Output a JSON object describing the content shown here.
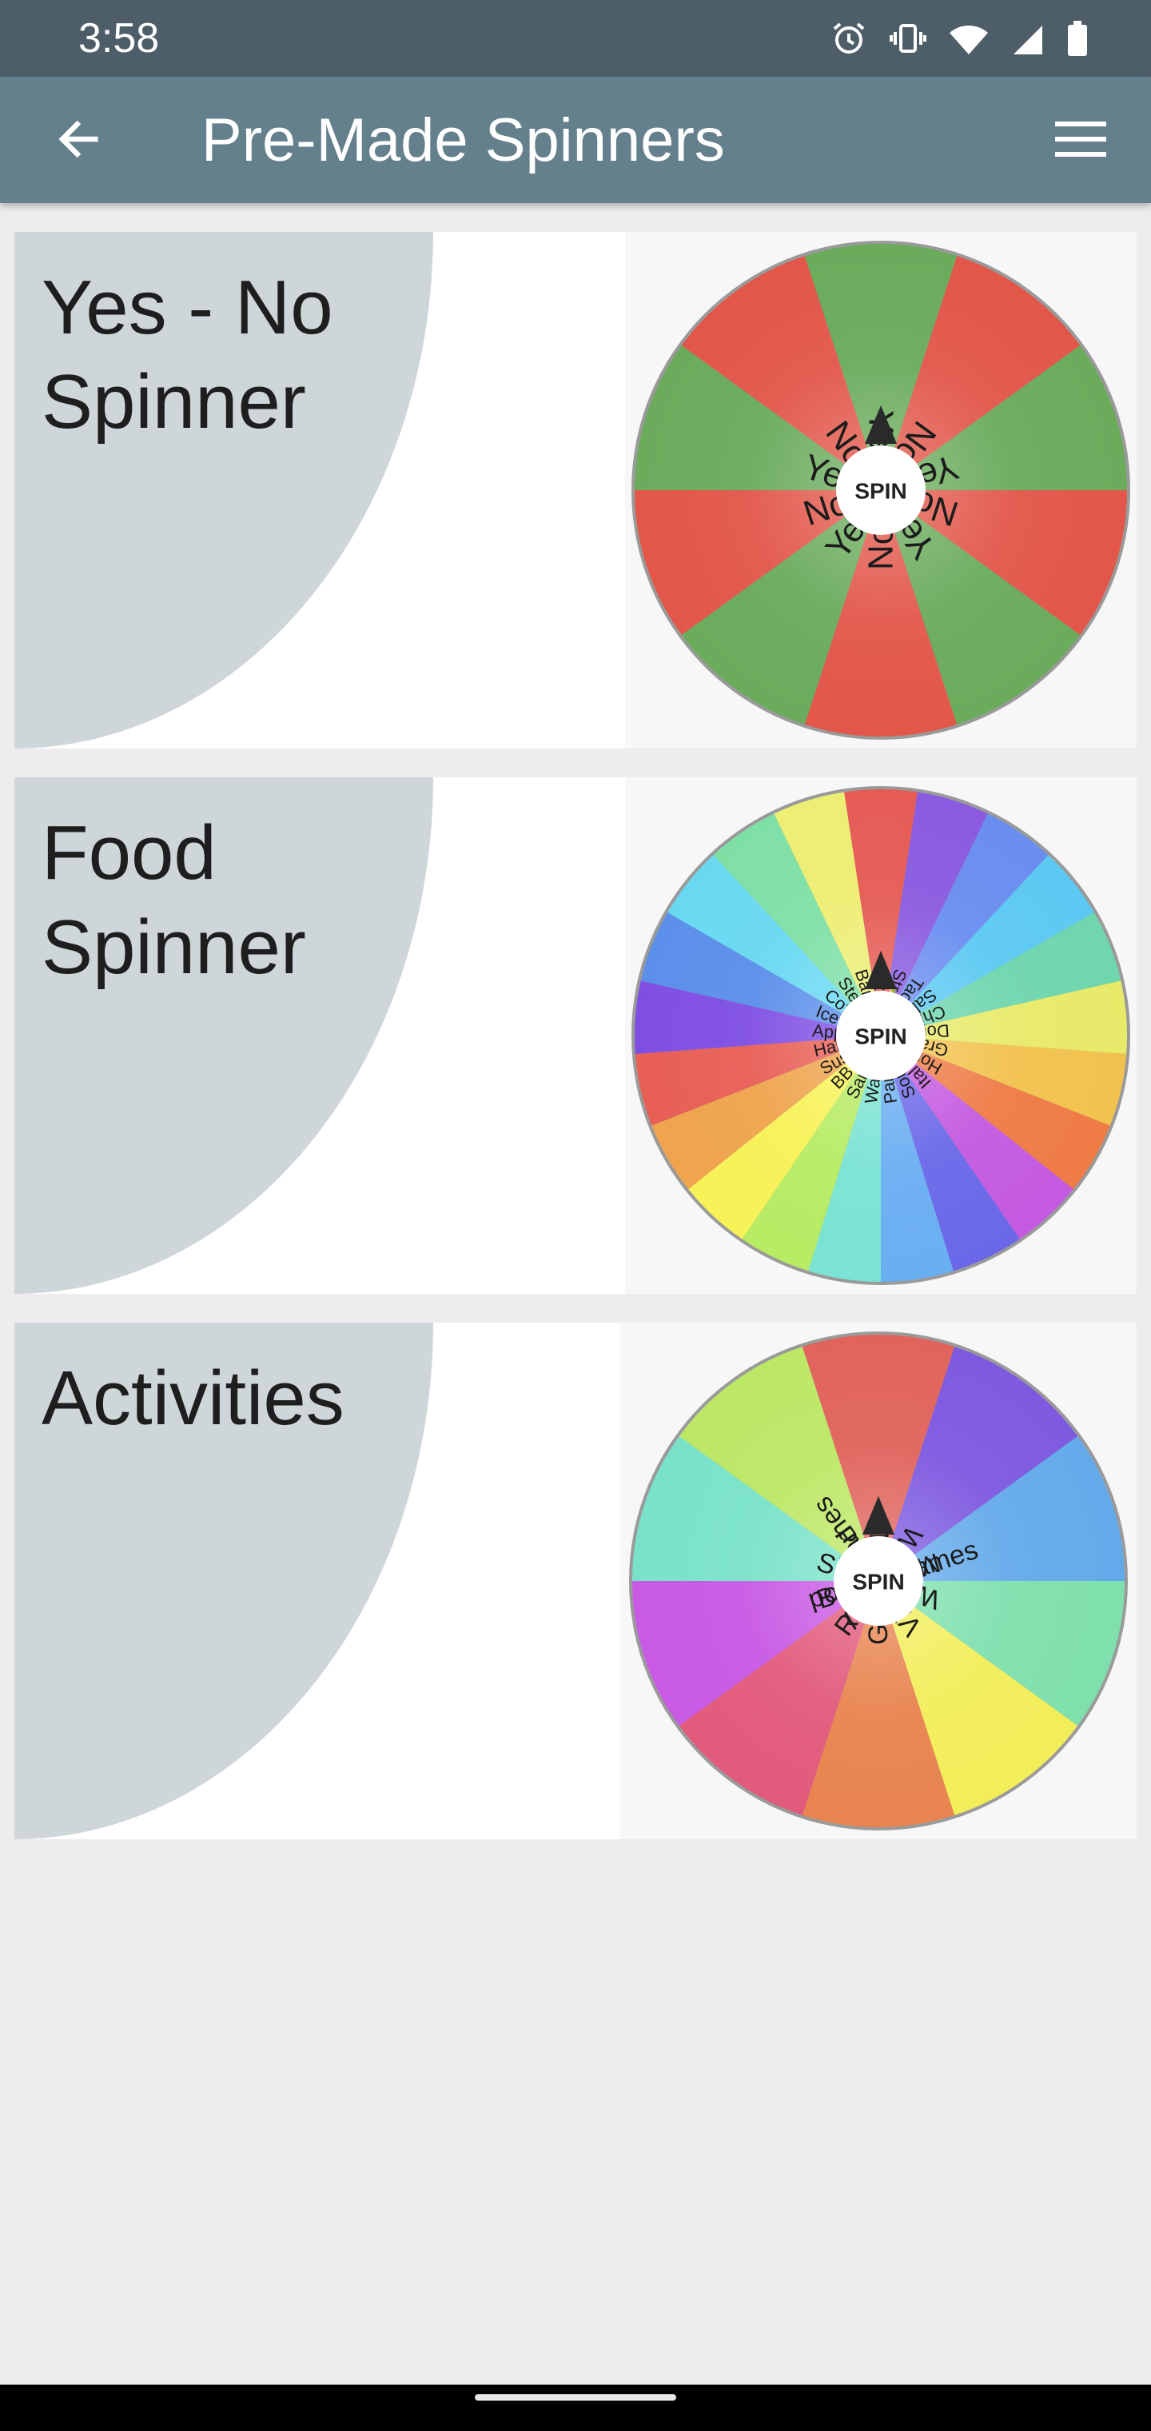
{
  "status_bar": {
    "time": "3:58",
    "icons": [
      "alarm-icon",
      "vibrate-icon",
      "wifi-icon",
      "signal-icon",
      "battery-icon"
    ]
  },
  "app_bar": {
    "title": "Pre-Made Spinners",
    "back_icon": "arrow-left-icon",
    "menu_icon": "hamburger-menu-icon",
    "color": "#65808d"
  },
  "spinners": [
    {
      "title": "Yes - No Spinner",
      "spin_label": "SPIN",
      "segments": [
        {
          "label": "Yes",
          "color": "#6aab5c"
        },
        {
          "label": "No",
          "color": "#e2574a"
        },
        {
          "label": "Yes",
          "color": "#6aab5c"
        },
        {
          "label": "No",
          "color": "#e2574a"
        },
        {
          "label": "Yes",
          "color": "#6aab5c"
        },
        {
          "label": "No",
          "color": "#e2574a"
        },
        {
          "label": "Yes",
          "color": "#6aab5c"
        },
        {
          "label": "No",
          "color": "#e2574a"
        },
        {
          "label": "Yes",
          "color": "#6aab5c"
        },
        {
          "label": "No",
          "color": "#e2574a"
        }
      ]
    },
    {
      "title": "Food Spinner",
      "spin_label": "SPIN",
      "segments": [
        {
          "label": "Pizza",
          "emoji": "🍕",
          "color": "#e55c55"
        },
        {
          "label": "Straberries",
          "emoji": "🍓",
          "color": "#8a5be0"
        },
        {
          "label": "Tacos",
          "emoji": "🌮",
          "color": "#6a8ef0"
        },
        {
          "label": "Salad",
          "emoji": "🥗",
          "color": "#5cc9f2"
        },
        {
          "label": "Chinese",
          "emoji": "🥡",
          "color": "#6fd6ae"
        },
        {
          "label": "Doughnuts",
          "emoji": "🍩",
          "color": "#e8ea6a"
        },
        {
          "label": "Grapes",
          "emoji": "🍇",
          "color": "#f2c24e"
        },
        {
          "label": "Hot Dog",
          "emoji": "🌭",
          "color": "#ef7b45"
        },
        {
          "label": "Italian",
          "emoji": "🍝",
          "color": "#c45ae0"
        },
        {
          "label": "Soup",
          "emoji": "🍜",
          "color": "#6a68e8"
        },
        {
          "label": "Pancakes",
          "emoji": "🥞",
          "color": "#6aaef2"
        },
        {
          "label": "Watermelon",
          "emoji": "🍉",
          "color": "#7ae3d3"
        },
        {
          "label": "Sandwich",
          "emoji": "🥪",
          "color": "#b7ec64"
        },
        {
          "label": "BBQ",
          "emoji": "🍖",
          "color": "#f7f257"
        },
        {
          "label": "Sushi",
          "emoji": "🍣",
          "color": "#efa44d"
        },
        {
          "label": "Hamburger",
          "emoji": "🍔",
          "color": "#e85f56"
        },
        {
          "label": "Apples",
          "emoji": "🍎",
          "color": "#7f4fe3"
        },
        {
          "label": "Ice Cream",
          "emoji": "🍦",
          "color": "#5b8fea"
        },
        {
          "label": "Coffee",
          "emoji": "☕",
          "color": "#69d9f2"
        },
        {
          "label": "Steak",
          "emoji": "🥩",
          "color": "#7fe0a6"
        },
        {
          "label": "Bananas",
          "emoji": "🍌",
          "color": "#edee74"
        }
      ]
    },
    {
      "title": "Activities",
      "spin_label": "SPIN",
      "segments": [
        {
          "label": "Movie",
          "color": "#e0645c"
        },
        {
          "label": "Watch TV",
          "color": "#7e5ae0"
        },
        {
          "label": "Make Food",
          "color": "#64aaea"
        },
        {
          "label": "Workout",
          "color": "#7fe0ad"
        },
        {
          "label": "Video Games",
          "color": "#f2ee5a"
        },
        {
          "label": "Go out",
          "color": "#e8844f"
        },
        {
          "label": "Read",
          "color": "#e25a7c"
        },
        {
          "label": "Board Games",
          "color": "#c85ae4"
        },
        {
          "label": "Sleep",
          "color": "#7ae2c9"
        },
        {
          "label": "Party",
          "color": "#bde866"
        }
      ]
    }
  ]
}
